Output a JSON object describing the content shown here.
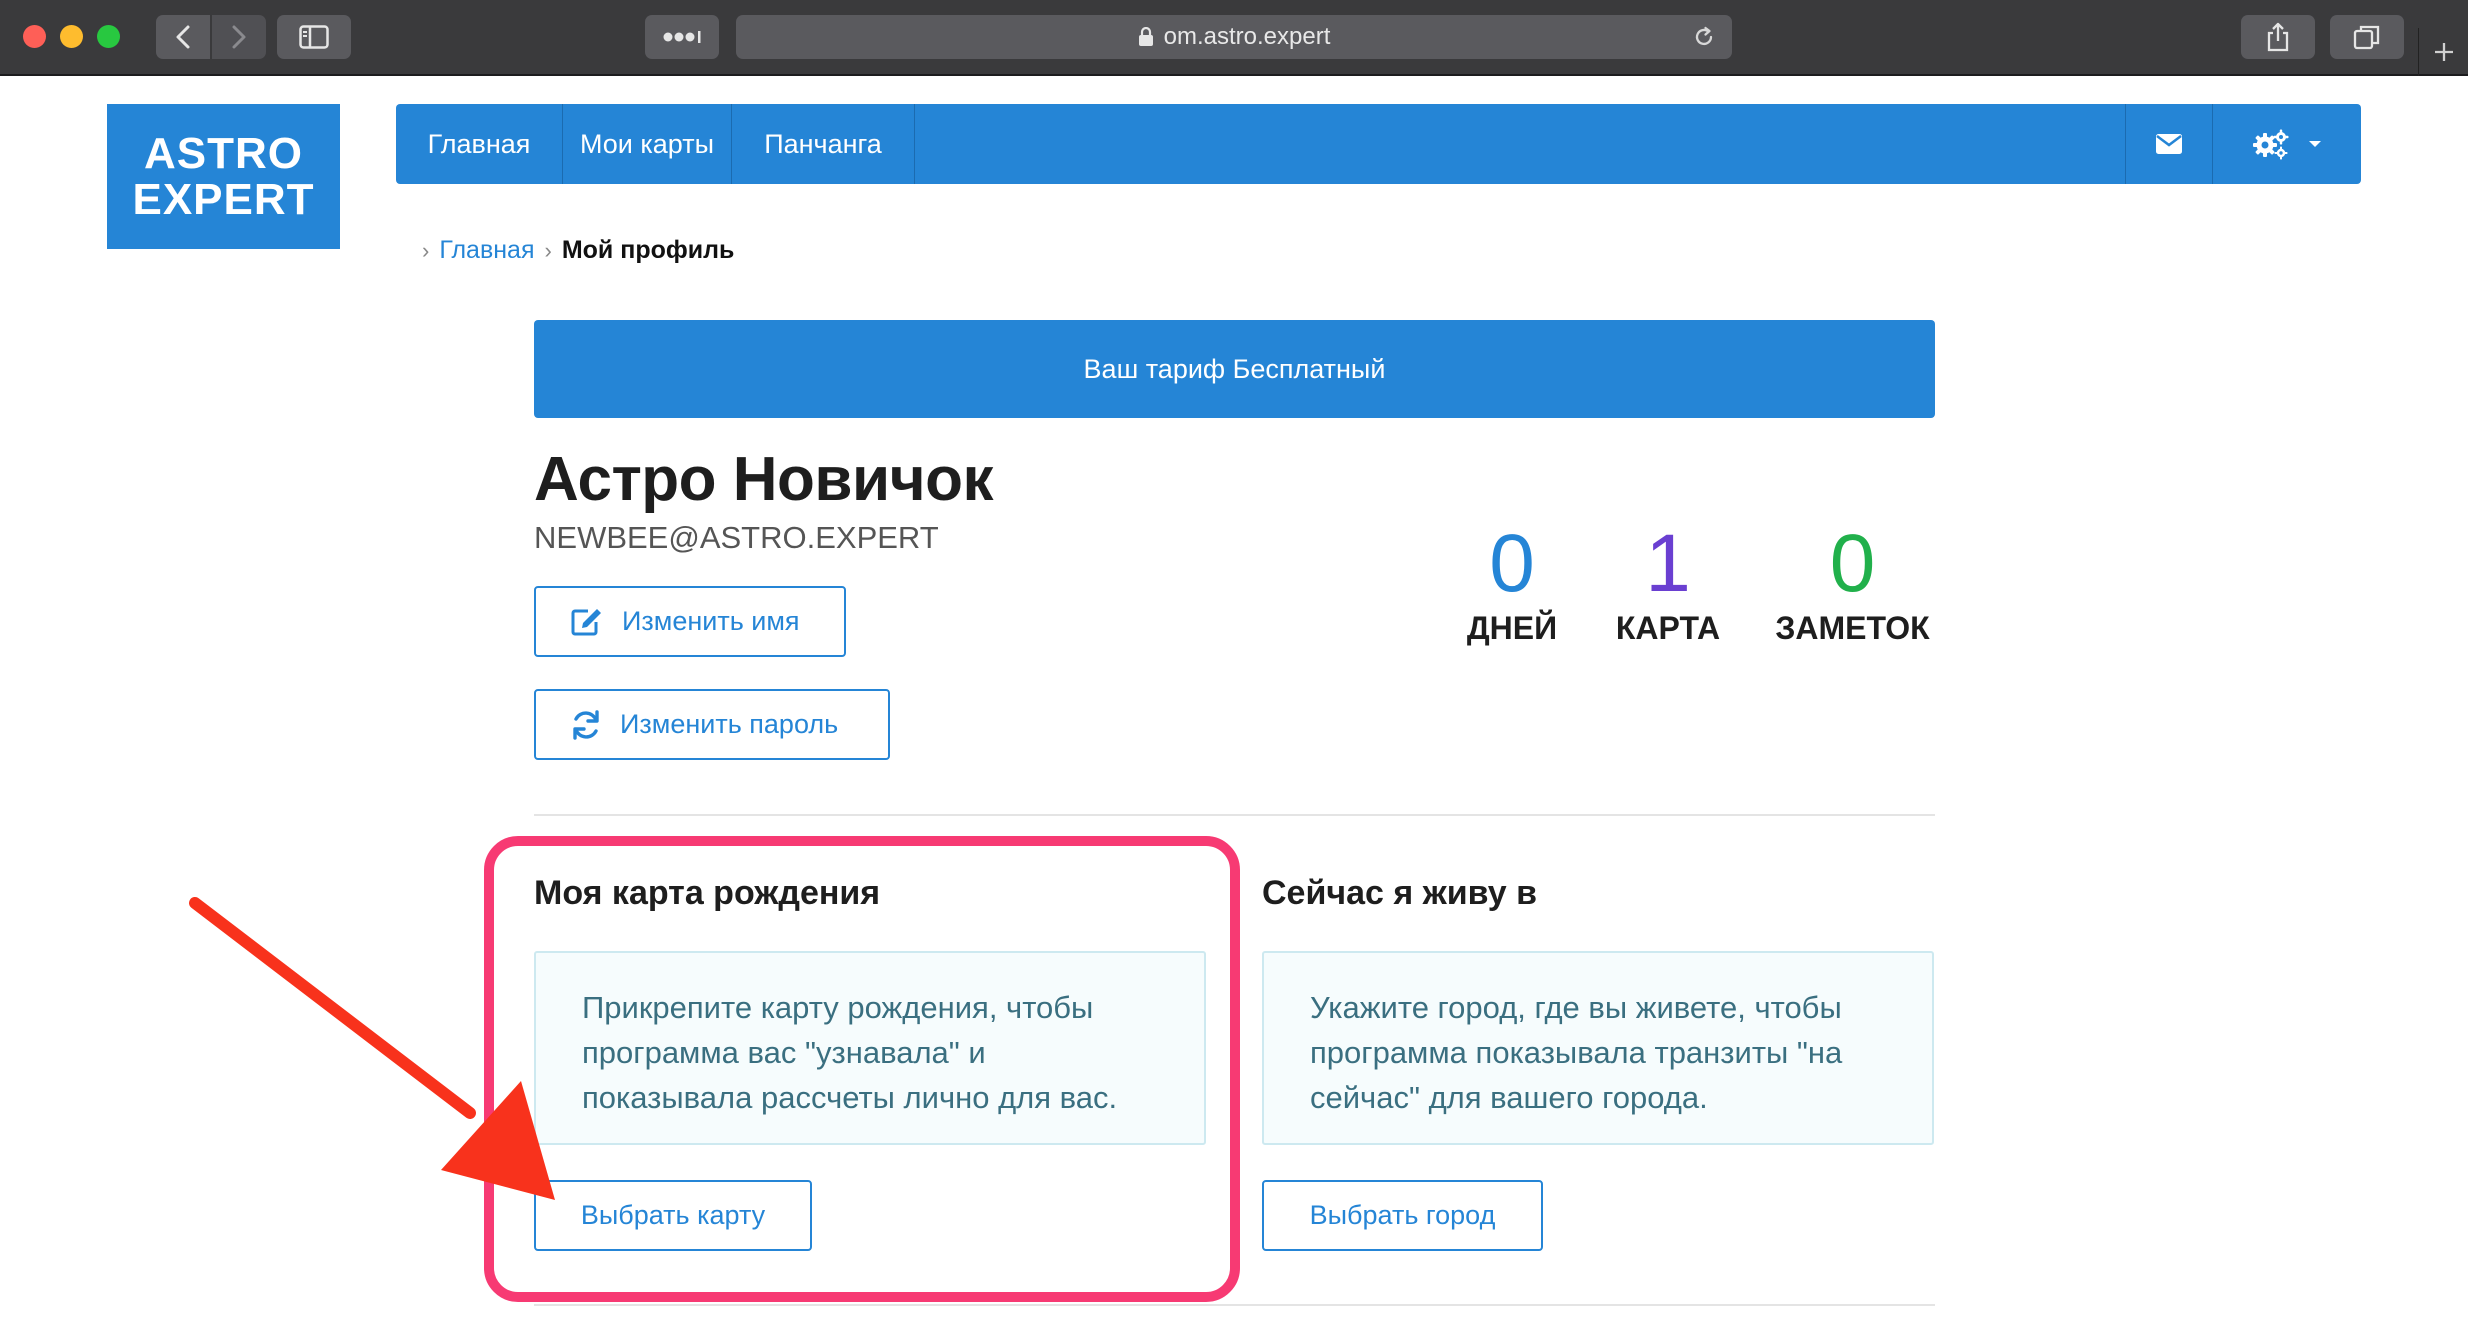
{
  "browser": {
    "url": "om.astro.expert"
  },
  "site": {
    "logo_line1": "ASTRO",
    "logo_line2": "EXPERT",
    "brand_color": "#2585d6"
  },
  "nav": {
    "items": [
      {
        "label": "Главная"
      },
      {
        "label": "Мои карты"
      },
      {
        "label": "Панчанга"
      }
    ],
    "icons": [
      "envelope-icon",
      "gears-icon",
      "caret-down-icon"
    ]
  },
  "breadcrumb": {
    "home": "Главная",
    "current": "Мой профиль"
  },
  "tariff_banner": "Ваш тариф Бесплатный",
  "profile": {
    "name": "Астро Новичок",
    "email": "NEWBEE@ASTRO.EXPERT",
    "rename_label": "Изменить имя",
    "password_label": "Изменить пароль"
  },
  "stats": [
    {
      "value": "0",
      "label": "ДНЕЙ",
      "color": "#2585d6"
    },
    {
      "value": "1",
      "label": "КАРТА",
      "color": "#6a3fd1"
    },
    {
      "value": "0",
      "label": "ЗАМЕТОК",
      "color": "#21b04b"
    }
  ],
  "birth_chart": {
    "title": "Моя карта рождения",
    "description": "Прикрепите карту рождения, чтобы программа вас \"узнавала\" и показывала рассчеты лично для вас.",
    "button_label": "Выбрать карту"
  },
  "living_place": {
    "title": "Сейчас я живу в",
    "description": "Укажите город, где вы живете, чтобы программа показывала транзиты \"на сейчас\" для вашего города.",
    "button_label": "Выбрать город"
  },
  "annotation": {
    "highlight_color": "#f73a73",
    "arrow_color": "#f8321c"
  }
}
